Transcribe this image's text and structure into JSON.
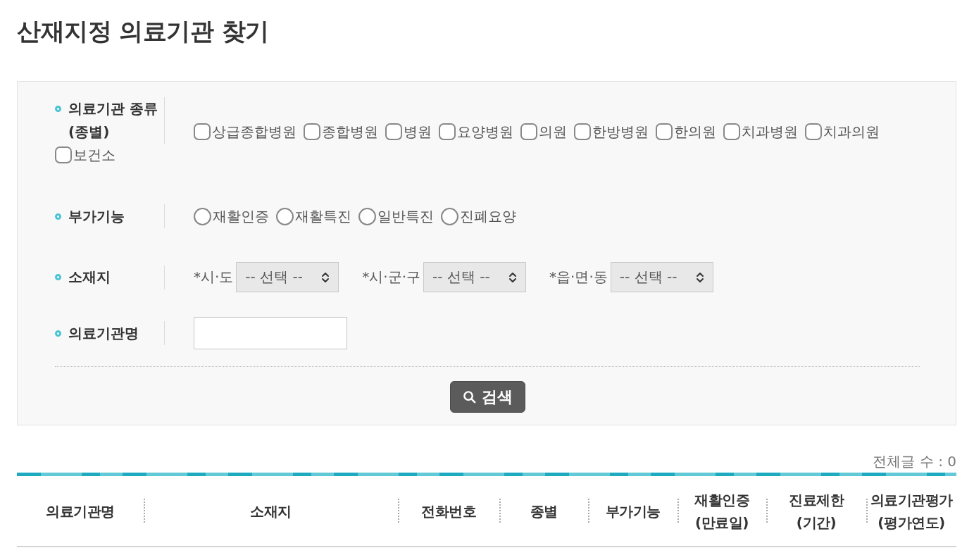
{
  "page": {
    "title": "산재지정 의료기관 찾기"
  },
  "search_form": {
    "rows": [
      {
        "kind": "checkboxes",
        "label": "의료기관 종류 (종별)",
        "options": [
          {
            "label": "상급종합병원",
            "checked": false
          },
          {
            "label": "종합병원",
            "checked": false
          },
          {
            "label": "병원",
            "checked": false
          },
          {
            "label": "요양병원",
            "checked": false
          },
          {
            "label": "의원",
            "checked": false
          },
          {
            "label": "한방병원",
            "checked": false
          },
          {
            "label": "한의원",
            "checked": false
          },
          {
            "label": "치과병원",
            "checked": false
          },
          {
            "label": "치과의원",
            "checked": false
          },
          {
            "label": "보건소",
            "checked": false
          }
        ]
      },
      {
        "kind": "radios",
        "label": "부가기능",
        "options": [
          {
            "label": "재활인증",
            "selected": false
          },
          {
            "label": "재활특진",
            "selected": false
          },
          {
            "label": "일반특진",
            "selected": false
          },
          {
            "label": "진폐요양",
            "selected": false
          }
        ]
      },
      {
        "kind": "selects",
        "label": "소재지",
        "selects": [
          {
            "label": "*시·도",
            "value": "-- 선택 --"
          },
          {
            "label": "*시·군·구",
            "value": "-- 선택 --"
          },
          {
            "label": "*읍·면·동",
            "value": "-- 선택 --"
          }
        ]
      },
      {
        "kind": "text_input",
        "label": "의료기관명"
      }
    ],
    "search_button": {
      "label": "검색"
    }
  },
  "results": {
    "total_count": "전체글 수 : 0",
    "table": {
      "columns": [
        "의료기관명",
        "소재지",
        "전화번호",
        "종별",
        "부가기능",
        "재활인증 (만료일)",
        "진료제한 (기간)",
        "의료기관평가 (평가연도)"
      ]
    }
  }
}
